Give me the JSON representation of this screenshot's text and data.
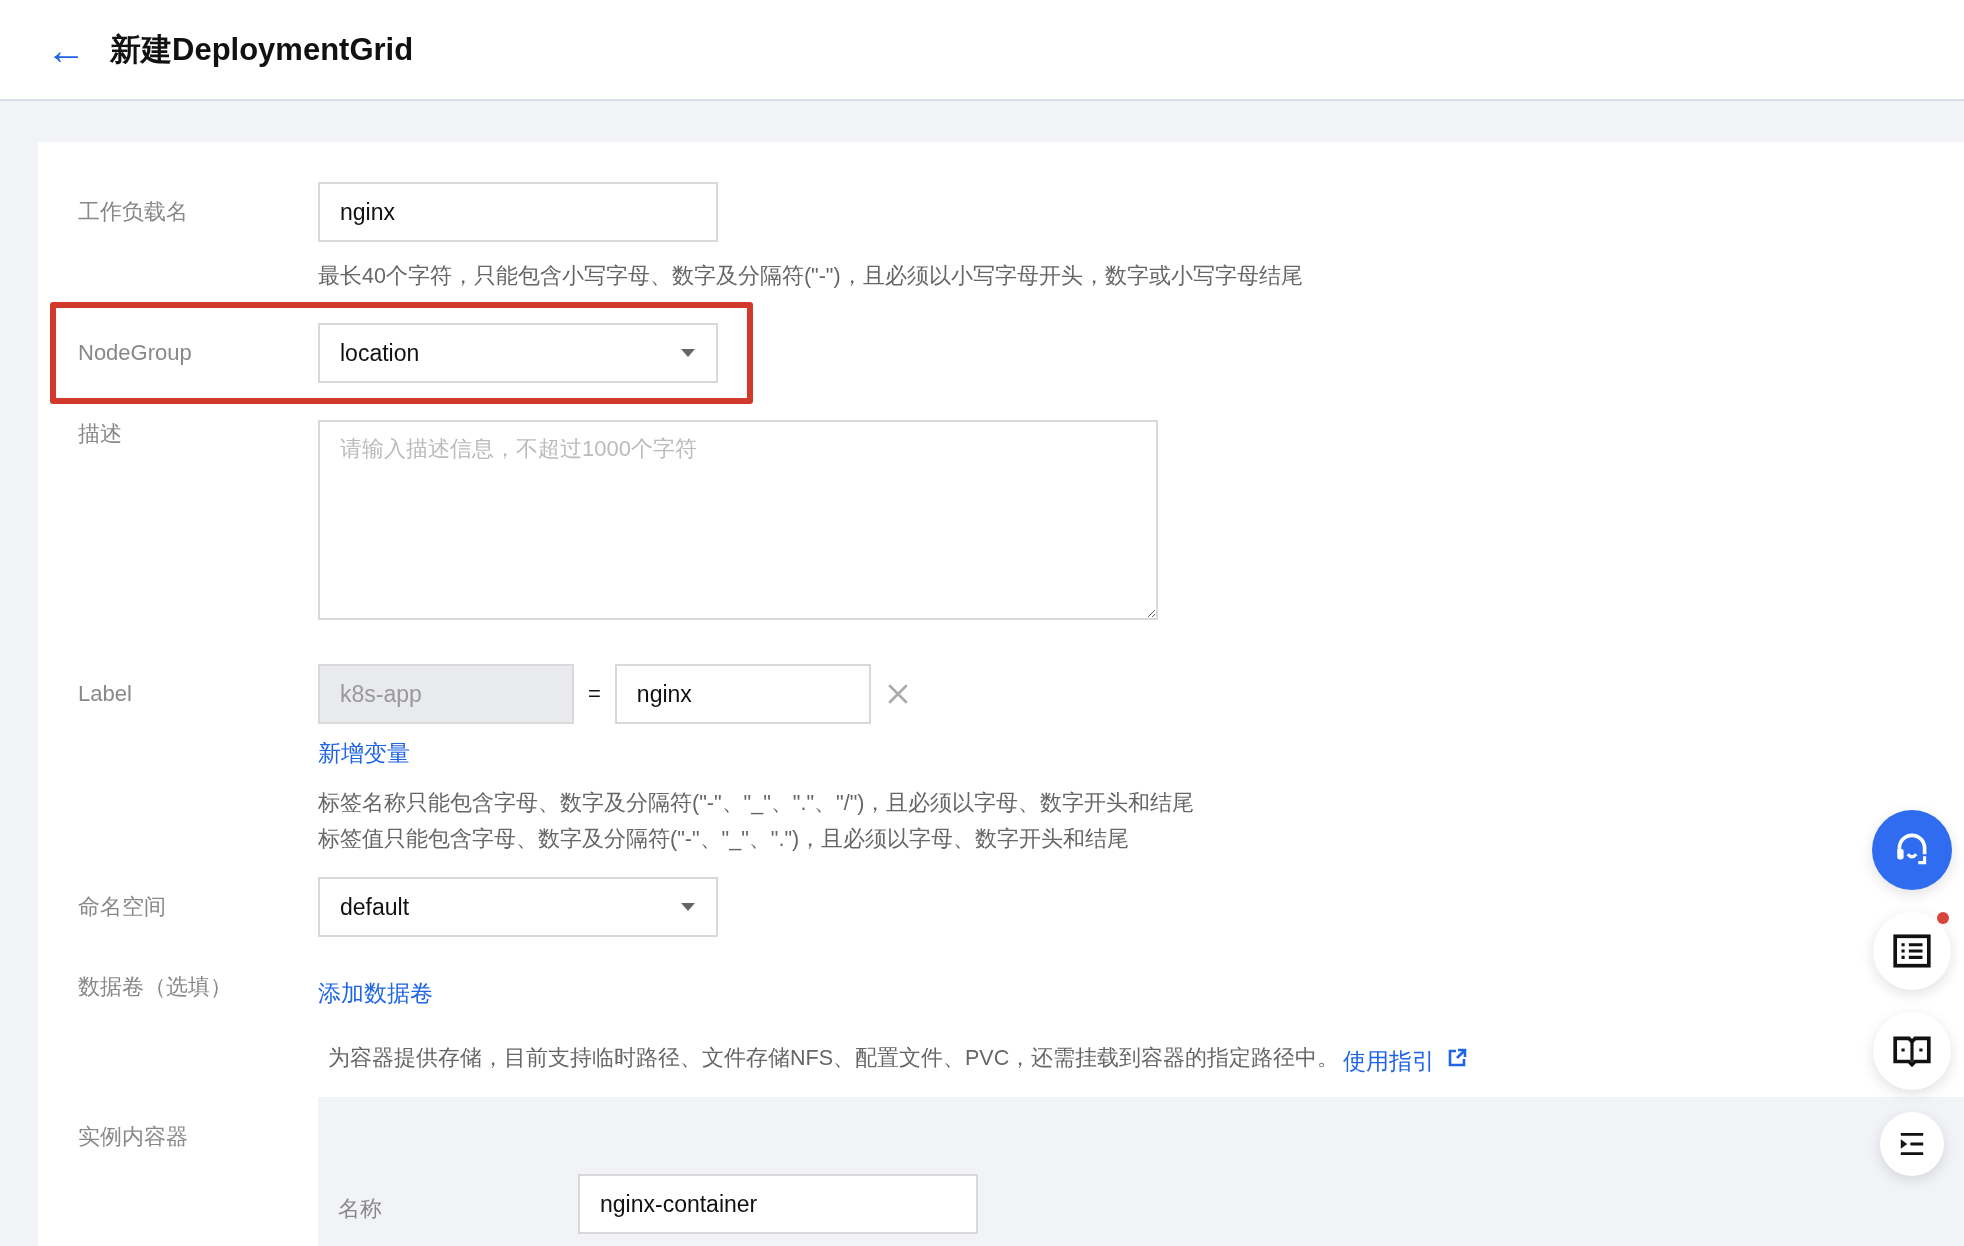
{
  "header": {
    "back_icon": "←",
    "title": "新建DeploymentGrid"
  },
  "workload_name": {
    "label": "工作负载名",
    "value": "nginx",
    "hint": "最长40个字符，只能包含小写字母、数字及分隔符(\"-\")，且必须以小写字母开头，数字或小写字母结尾"
  },
  "node_group": {
    "label": "NodeGroup",
    "value": "location",
    "highlighted": true
  },
  "description": {
    "label": "描述",
    "placeholder": "请输入描述信息，不超过1000个字符"
  },
  "labels": {
    "label": "Label",
    "rows": [
      {
        "key": "k8s-app",
        "key_disabled": true,
        "equals": "=",
        "value": "nginx"
      }
    ],
    "add_link": "新增变量",
    "hints": [
      "标签名称只能包含字母、数字及分隔符(\"-\"、\"_\"、\".\"、\"/\")，且必须以字母、数字开头和结尾",
      "标签值只能包含字母、数字及分隔符(\"-\"、\"_\"、\".\")，且必须以字母、数字开头和结尾"
    ]
  },
  "namespace": {
    "label": "命名空间",
    "value": "default"
  },
  "volumes": {
    "label": "数据卷（选填）",
    "add_link": "添加数据卷",
    "hint": "为容器提供存储，目前支持临时路径、文件存储NFS、配置文件、PVC，还需挂载到容器的指定路径中。",
    "guide_link": "使用指引"
  },
  "containers": {
    "label": "实例内容器",
    "name_label": "名称",
    "name_value": "nginx-container"
  },
  "float_buttons": [
    {
      "kind": "support",
      "badge": false
    },
    {
      "kind": "list",
      "badge": true
    },
    {
      "kind": "book",
      "badge": false
    },
    {
      "kind": "collapse",
      "badge": false
    }
  ]
}
